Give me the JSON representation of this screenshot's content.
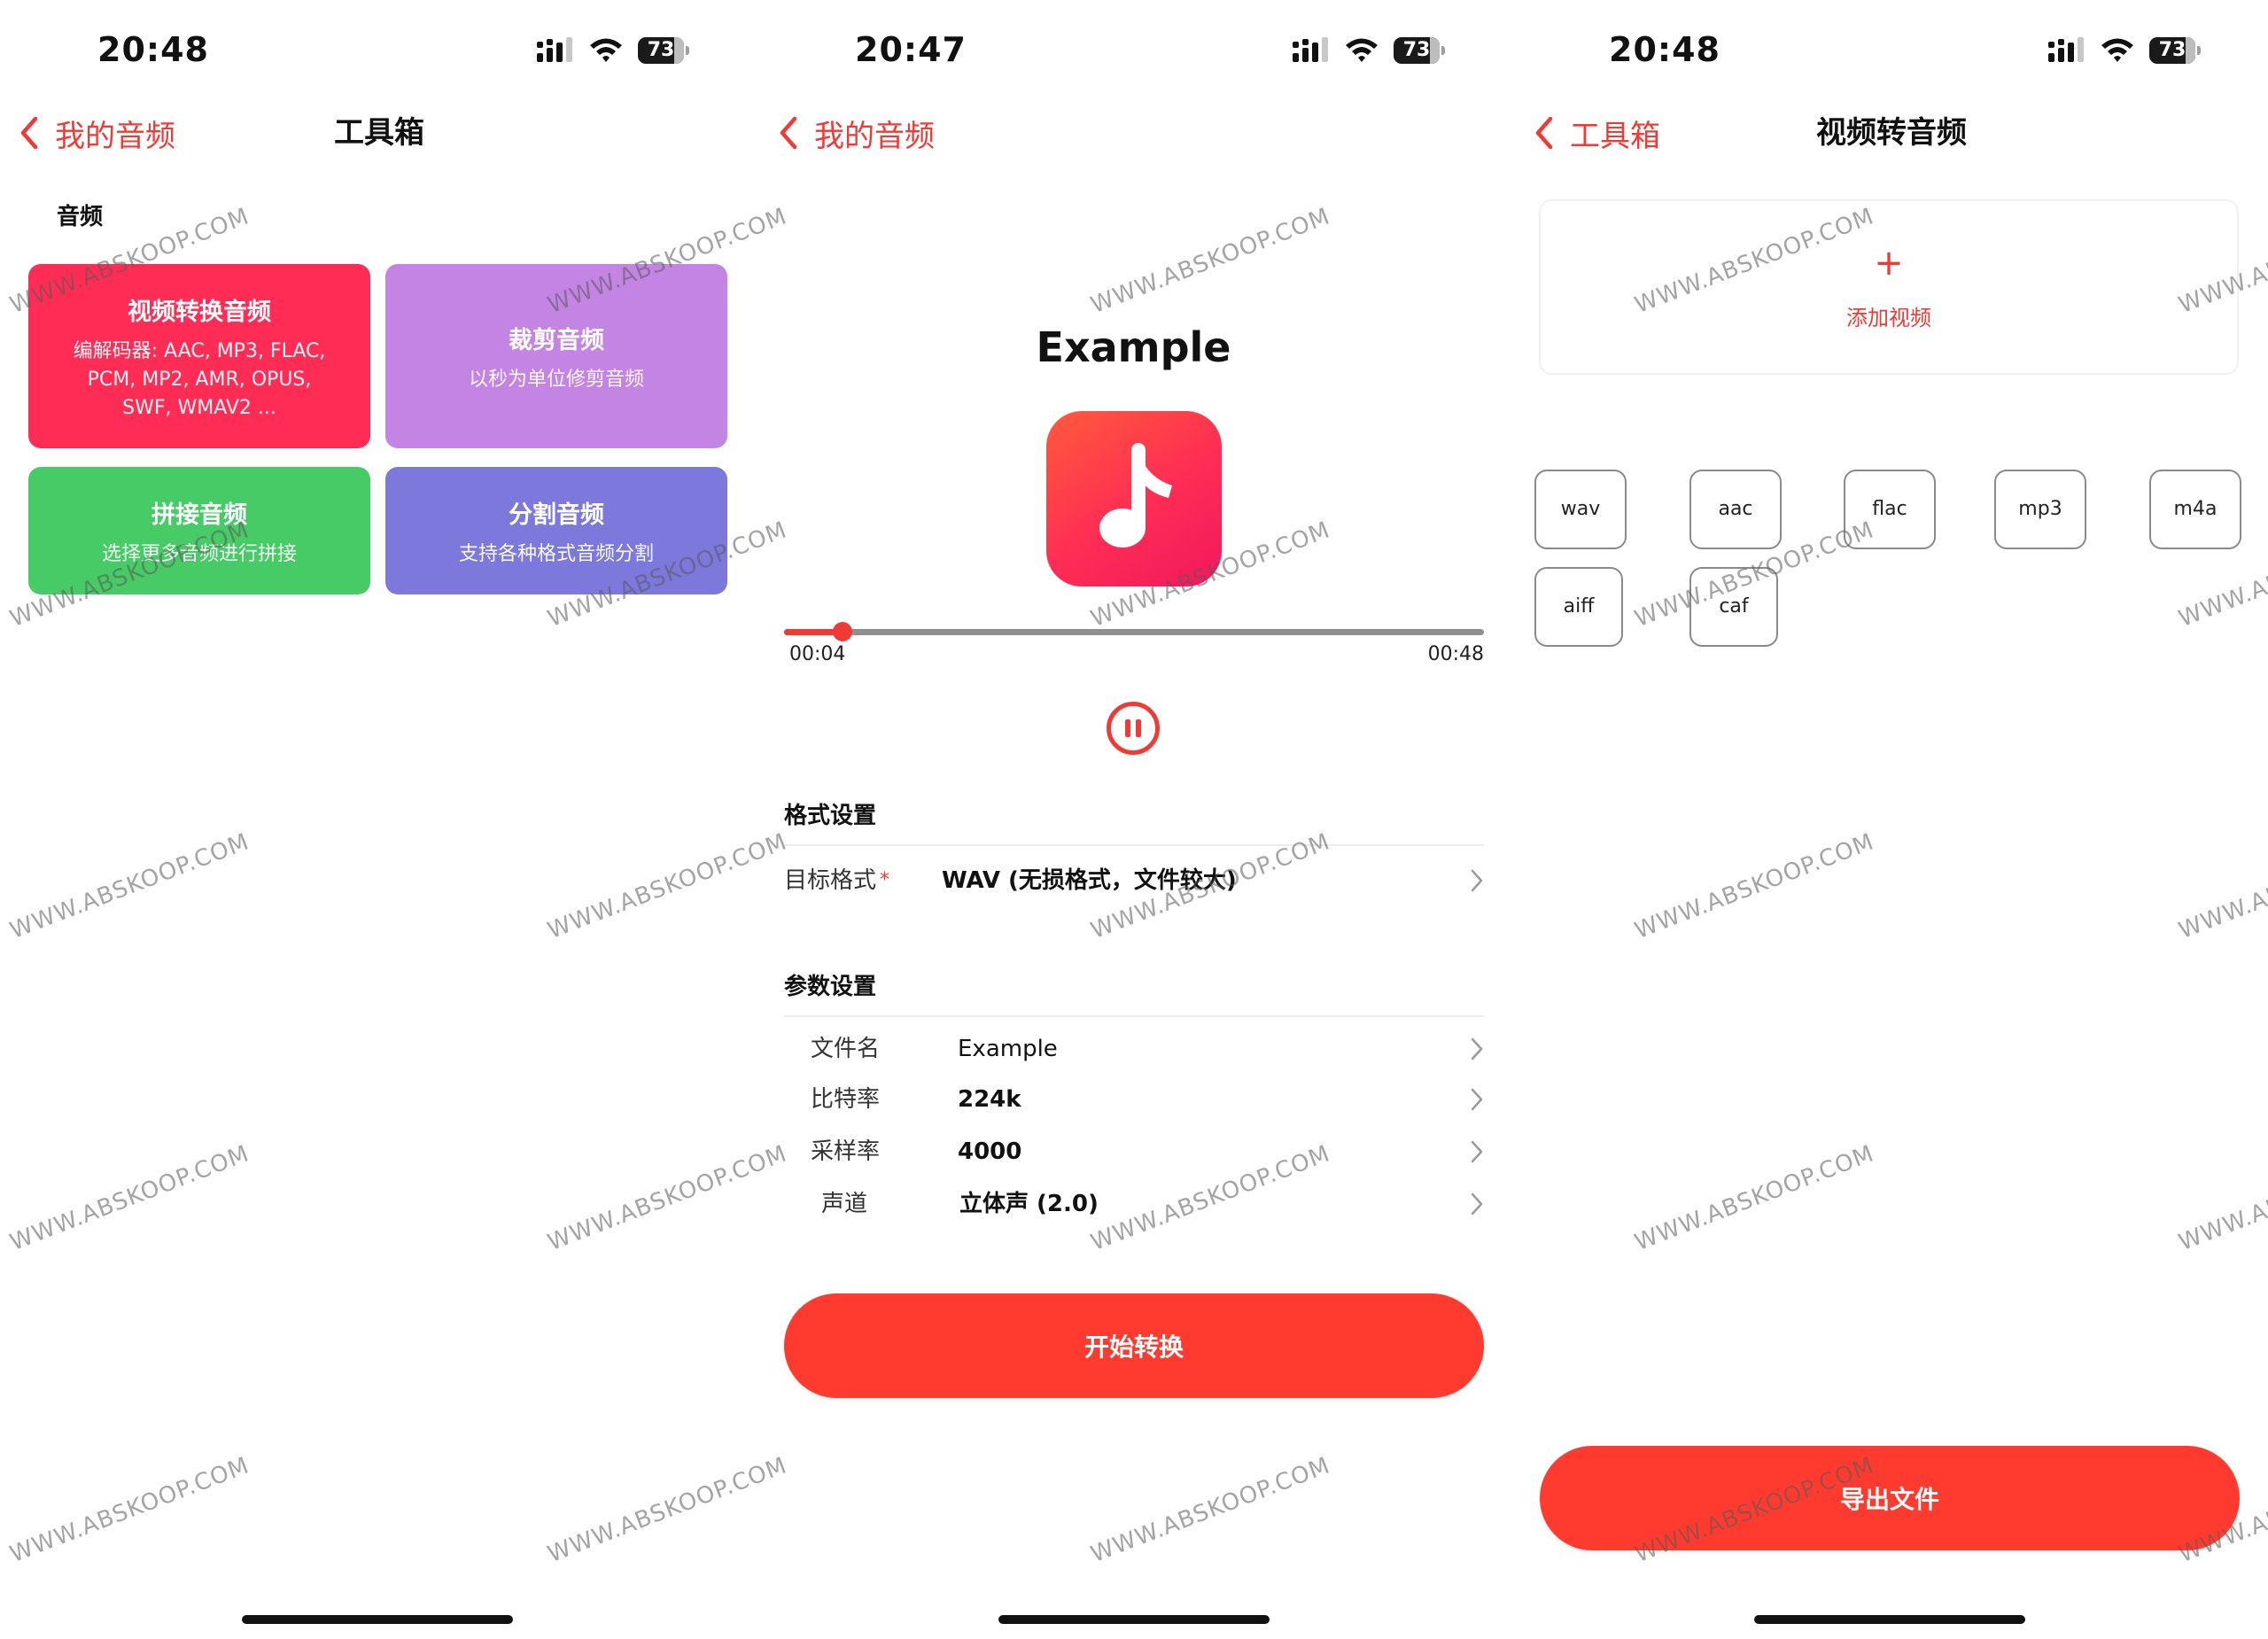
{
  "screens": [
    {
      "status": {
        "time": "20:48",
        "battery": "73"
      },
      "nav": {
        "back": "我的音频",
        "title": "工具箱"
      },
      "section": "音频",
      "cards": [
        {
          "title": "视频转换音频",
          "lines": [
            "编解码器: AAC, MP3, FLAC,",
            "PCM, MP2, AMR, OPUS,",
            "SWF, WMAV2 ..."
          ],
          "color": "#ff2d55"
        },
        {
          "title": "裁剪音频",
          "lines": [
            "以秒为单位修剪音频"
          ],
          "color": "#c484e4"
        },
        {
          "title": "拼接音频",
          "lines": [
            "选择更多音频进行拼接"
          ],
          "color": "#47cb67"
        },
        {
          "title": "分割音频",
          "lines": [
            "支持各种格式音频分割"
          ],
          "color": "#7c78dc"
        }
      ]
    },
    {
      "status": {
        "time": "20:47",
        "battery": "73"
      },
      "nav": {
        "back": "我的音频",
        "title": ""
      },
      "title": "Example",
      "player": {
        "current": "00:04",
        "total": "00:48",
        "progress": 0.0833
      },
      "format_section": {
        "title": "格式设置",
        "target_label": "目标格式",
        "required_mark": "*",
        "target_value": "WAV (无损格式，文件较大)"
      },
      "params_section": {
        "title": "参数设置",
        "rows": [
          {
            "label": "文件名",
            "value": "Example"
          },
          {
            "label": "比特率",
            "value": "224k"
          },
          {
            "label": "采样率",
            "value": "4000"
          },
          {
            "label": "声道",
            "value": "立体声 (2.0)"
          }
        ]
      },
      "start_button": "开始转换"
    },
    {
      "status": {
        "time": "20:48",
        "battery": "73"
      },
      "nav": {
        "back": "工具箱",
        "title": "视频转音频"
      },
      "add_plus": "+",
      "add_video": "添加视频",
      "formats": [
        "wav",
        "aac",
        "flac",
        "mp3",
        "m4a",
        "aiff",
        "caf"
      ],
      "export_button": "导出文件"
    }
  ],
  "watermark": "WWW.ABSKOOP.COM",
  "icons": {
    "back": "chevron-left-icon",
    "chevron": "chevron-right-icon",
    "app": "music-note-icon",
    "pause": "pause-icon",
    "signal": "cellular-signal-icon",
    "wifi": "wifi-icon",
    "battery": "battery-icon"
  },
  "colors": {
    "accent": "#ef3a36",
    "button": "#ff3b30"
  }
}
